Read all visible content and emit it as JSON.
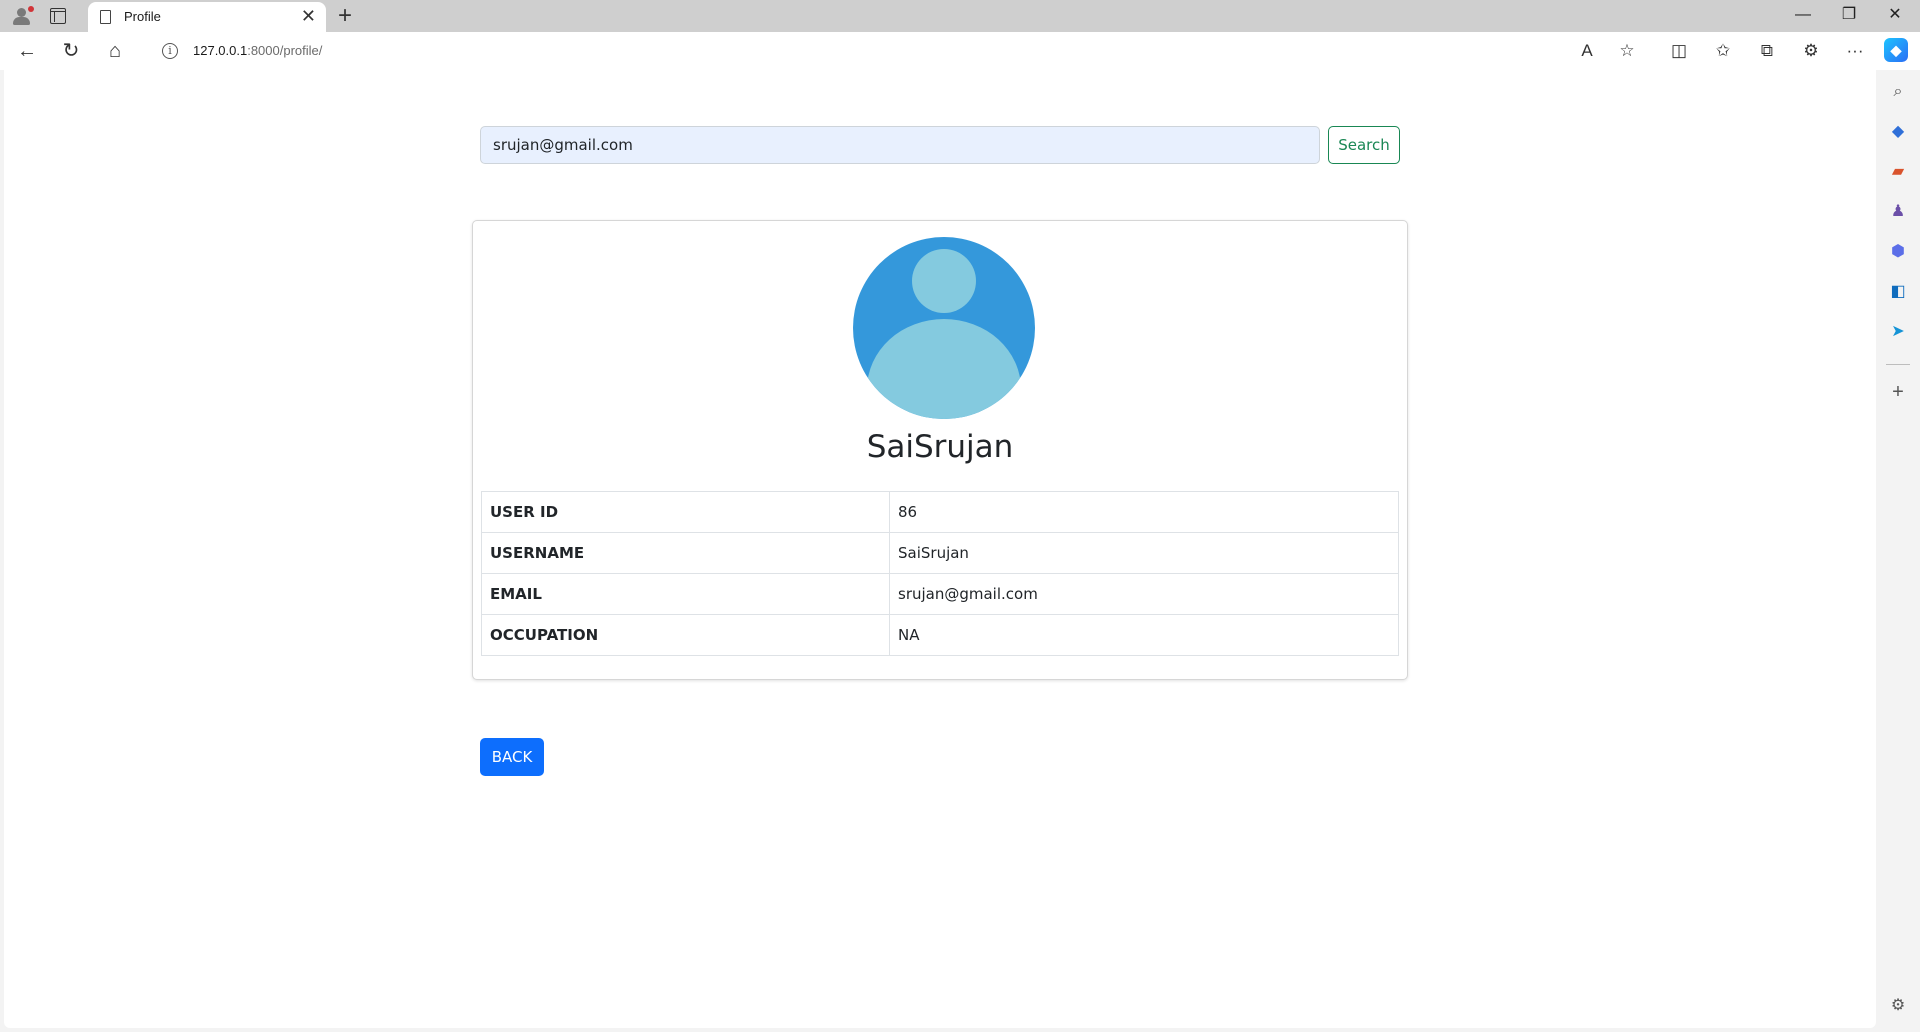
{
  "browser": {
    "tab_title": "Profile",
    "tab_close": "✕",
    "new_tab": "+",
    "url_host": "127.0.0.1",
    "url_rest": ":8000/profile/",
    "window_controls": {
      "minimize": "—",
      "restore": "❐",
      "close": "✕"
    },
    "nav": {
      "back": "←",
      "refresh": "↻",
      "home": "⌂"
    },
    "toolbar_icons": {
      "read_aloud": "A",
      "favorite": "☆",
      "split": "◫",
      "favorites": "✩",
      "collections": "⧉",
      "extensions": "⚙",
      "more": "···"
    }
  },
  "search": {
    "value": "srujan@gmail.com",
    "button_label": "Search"
  },
  "profile": {
    "display_name": "SaiSrujan",
    "fields": [
      {
        "key": "USER ID",
        "value": "86"
      },
      {
        "key": "USERNAME",
        "value": "SaiSrujan"
      },
      {
        "key": "EMAIL",
        "value": "srujan@gmail.com"
      },
      {
        "key": "OCCUPATION",
        "value": "NA"
      }
    ]
  },
  "back_button_label": "BACK",
  "colors": {
    "primary": "#0d6efd",
    "success": "#198754",
    "avatar_bg": "#3498db",
    "avatar_fg": "#84cadf",
    "input_bg": "#e8f0fe"
  }
}
